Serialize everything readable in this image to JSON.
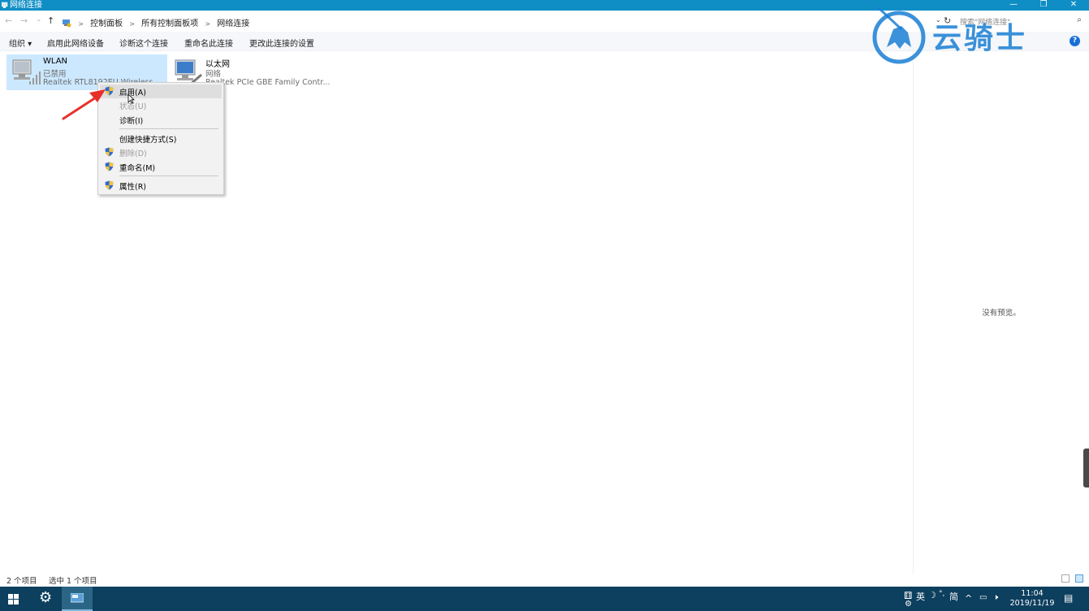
{
  "window": {
    "title": "网络连接",
    "min": "—",
    "max": "❐",
    "close": "✕"
  },
  "address": {
    "back": "←",
    "forward": "→",
    "recent": "⌄",
    "up": "↑",
    "crumbs": [
      "控制面板",
      "所有控制面板项",
      "网络连接"
    ],
    "search_placeholder": "搜索\"网络连接\""
  },
  "toolbar": {
    "organize": "组织 ▾",
    "enable": "启用此网络设备",
    "diagnose": "诊断这个连接",
    "rename": "重命名此连接",
    "change": "更改此连接的设置",
    "help": "?"
  },
  "items": [
    {
      "name": "WLAN",
      "status": "已禁用",
      "device": "Realtek RTL8192EU Wireless..."
    },
    {
      "name": "以太网",
      "status": "网络",
      "device": "Realtek PCIe GBE Family Contr..."
    }
  ],
  "context_menu": [
    {
      "label": "启用(A)",
      "shield": true,
      "disabled": false,
      "bold": true
    },
    {
      "label": "状态(U)",
      "shield": false,
      "disabled": true
    },
    {
      "label": "诊断(I)",
      "shield": false,
      "disabled": false
    },
    {
      "label": "创建快捷方式(S)",
      "shield": false,
      "disabled": false
    },
    {
      "label": "删除(D)",
      "shield": true,
      "disabled": true
    },
    {
      "label": "重命名(M)",
      "shield": true,
      "disabled": false
    },
    {
      "label": "属性(R)",
      "shield": true,
      "disabled": false
    }
  ],
  "preview": {
    "message": "没有预览。"
  },
  "status": {
    "count": "2 个项目",
    "selected": "选中 1 个项目"
  },
  "watermark": {
    "text": "云骑士"
  },
  "taskbar": {
    "ime": "英",
    "ime_mode": "简",
    "time": "11:04",
    "date": "2019/11/19"
  },
  "colors": {
    "titlebar": "#0f8ec6",
    "taskbar": "#0d3f5e",
    "selection": "#cce8ff",
    "arrow": "#e8302a",
    "watermark": "#1a7fd4"
  }
}
